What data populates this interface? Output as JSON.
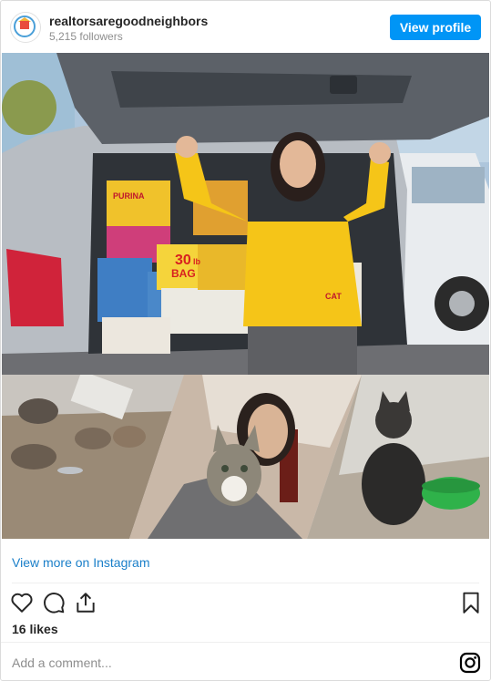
{
  "header": {
    "username": "realtorsaregoodneighbors",
    "followers": "5,215 followers",
    "view_profile_label": "View profile"
  },
  "post": {
    "main_photo": "woman-with-pet-food-bags-photo",
    "collage_photos": [
      "feral-cats-photo",
      "woman-holding-cat-photo",
      "cat-with-bowl-photo"
    ],
    "bag_labels": {
      "bag_30": "30",
      "bag_lb": "lb",
      "bag_word": "BAG",
      "cat_brand": "PURINA",
      "cat_label": "CAT"
    }
  },
  "footer": {
    "view_more_label": "View more on Instagram",
    "likes": "16 likes",
    "comment_placeholder": "Add a comment...",
    "action_icons": [
      "heart-icon",
      "comment-icon",
      "share-icon",
      "bookmark-icon",
      "instagram-icon"
    ]
  },
  "colors": {
    "accent": "#0095f6",
    "link": "#1a7fc9",
    "text": "#262626",
    "muted": "#8e8e8e"
  }
}
